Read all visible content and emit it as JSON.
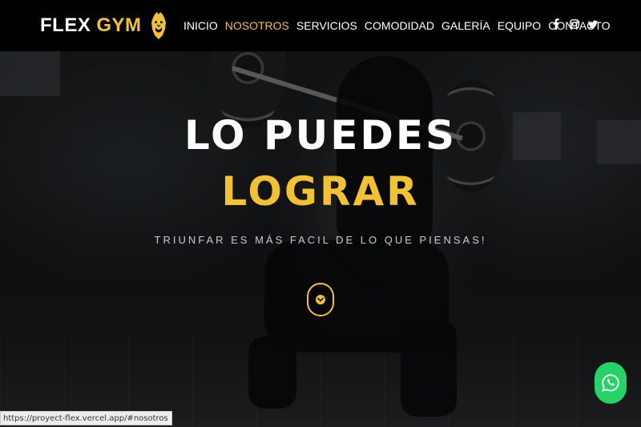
{
  "brand": {
    "name_part1": "FLEX",
    "name_part2": "GYM",
    "logo_icon": "gorilla-icon"
  },
  "nav": {
    "items": [
      {
        "label": "INICIO",
        "active": false
      },
      {
        "label": "NOSOTROS",
        "active": true
      },
      {
        "label": "SERVICIOS",
        "active": false
      },
      {
        "label": "COMODIDAD",
        "active": false
      },
      {
        "label": "GALERÍA",
        "active": false
      },
      {
        "label": "EQUIPO",
        "active": false
      },
      {
        "label": "CONTACTO",
        "active": false
      }
    ]
  },
  "socials": [
    "facebook-icon",
    "instagram-icon",
    "twitter-icon"
  ],
  "hero": {
    "headline_line1": "LO PUEDES",
    "headline_line2": "LOGRAR",
    "tagline": "TRIUNFAR ES MÁS FACIL DE LO QUE PIENSAS!",
    "scroll_icon": "chevron-down-icon"
  },
  "whatsapp_icon": "whatsapp-icon",
  "statusbar": {
    "url": "https://proyect-flex.vercel.app/#nosotros"
  },
  "colors": {
    "accent": "#f2c230",
    "navbar_bg": "#000000",
    "whatsapp_green": "#25d366",
    "text_light": "#ffffff",
    "tagline": "#c9ccd0"
  }
}
